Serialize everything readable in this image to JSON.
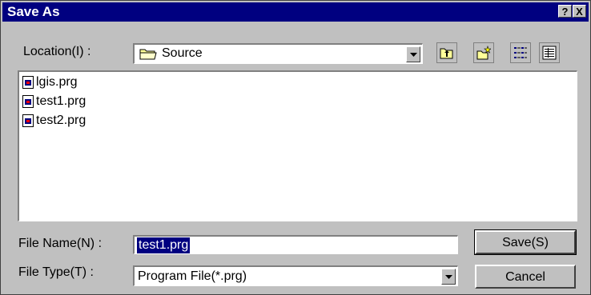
{
  "dialog": {
    "title": "Save As",
    "help_button": "?",
    "close_button": "X"
  },
  "location": {
    "label": "Location(I) :",
    "value": "Source"
  },
  "toolbar": {
    "buttons": [
      "up-one-level-icon",
      "new-folder-icon",
      "list-view-icon",
      "details-view-icon"
    ]
  },
  "files": [
    {
      "name": "lgis.prg"
    },
    {
      "name": "test1.prg"
    },
    {
      "name": "test2.prg"
    }
  ],
  "file_name": {
    "label": "File Name(N) :",
    "value": "test1.prg"
  },
  "file_type": {
    "label": "File Type(T) :",
    "value": "Program File(*.prg)"
  },
  "buttons": {
    "save": "Save(S)",
    "cancel": "Cancel"
  },
  "colors": {
    "titlebar": "#000080",
    "face": "#c0c0c0",
    "selection": "#000080"
  }
}
